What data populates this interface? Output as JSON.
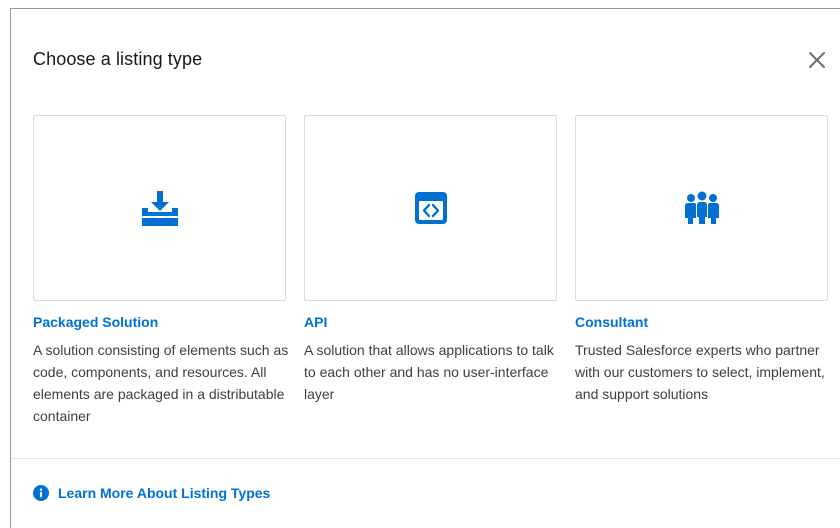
{
  "modal": {
    "title": "Choose a listing type",
    "close_icon": "close-icon"
  },
  "cards": [
    {
      "title": "Packaged Solution",
      "description": "A solution consisting of elements such as code, components, and resources. All elements are packaged in a distributable container",
      "icon": "package-download-icon"
    },
    {
      "title": "API",
      "description": "A solution that allows applications to talk to each other and has no user-interface layer",
      "icon": "api-code-window-icon"
    },
    {
      "title": "Consultant",
      "description": "Trusted Salesforce experts who partner with our customers to select, implement, and support solutions",
      "icon": "people-group-icon"
    }
  ],
  "footer": {
    "learn_more_label": "Learn More About Listing Types",
    "info_icon": "info-icon"
  },
  "colors": {
    "accent": "#0070d2",
    "text": "#3e3e3c",
    "border": "#dddbda"
  }
}
